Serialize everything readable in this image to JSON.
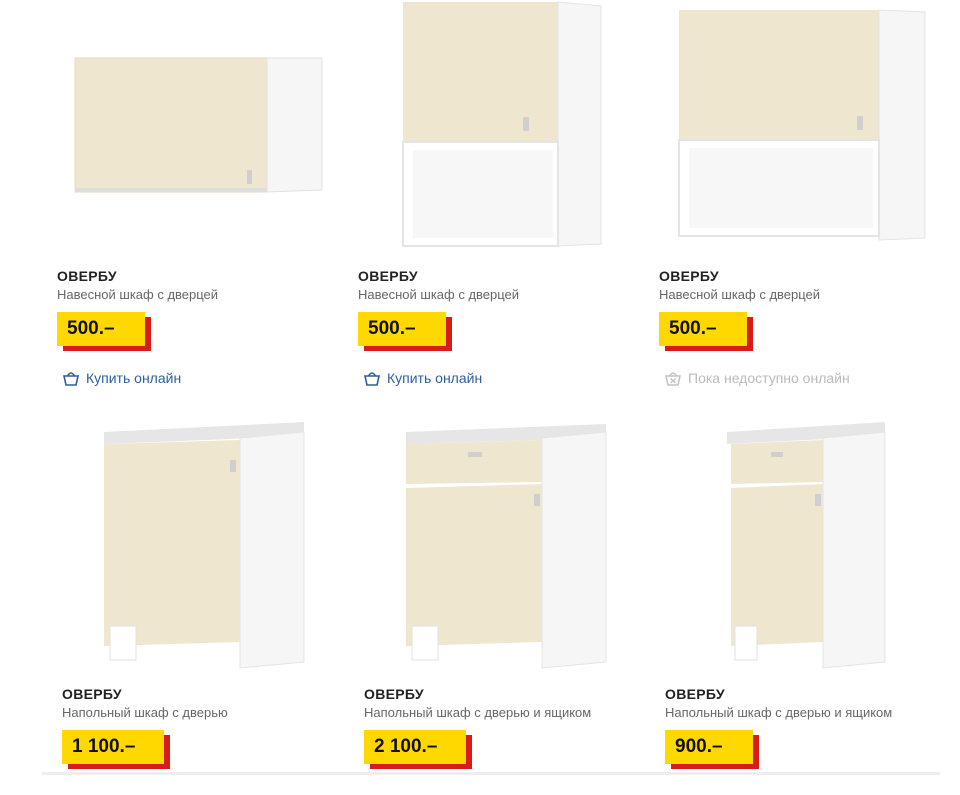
{
  "products": [
    {
      "brand": "ОВЕРБУ",
      "desc": "Навесной шкаф с дверцей",
      "price": "500.–",
      "action": "Купить онлайн",
      "available": true,
      "icon": "basket-icon"
    },
    {
      "brand": "ОВЕРБУ",
      "desc": "Навесной шкаф с дверцей",
      "price": "500.–",
      "action": "Купить онлайн",
      "available": true,
      "icon": "basket-icon"
    },
    {
      "brand": "ОВЕРБУ",
      "desc": "Навесной шкаф с дверцей",
      "price": "500.–",
      "action": "Пока недоступно онлайн",
      "available": false,
      "icon": "unavailable-basket-icon"
    },
    {
      "brand": "ОВЕРБУ",
      "desc": "Напольный шкаф с дверью",
      "price": "1 100.–"
    },
    {
      "brand": "ОВЕРБУ",
      "desc": "Напольный шкаф с дверью и ящиком",
      "price": "2 100.–"
    },
    {
      "brand": "ОВЕРБУ",
      "desc": "Напольный шкаф с дверью и ящиком",
      "price": "900.–"
    }
  ],
  "colors": {
    "price_bg": "#ffd800",
    "price_shadow": "#d81c1c",
    "link": "#2c5f9e",
    "cabinet_front": "#efe6cf",
    "cabinet_body": "#f4f4f4"
  }
}
